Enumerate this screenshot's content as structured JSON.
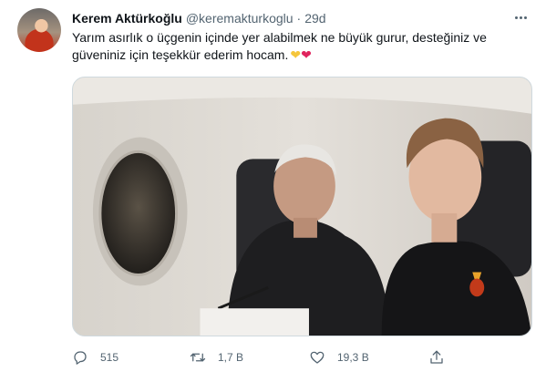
{
  "author": {
    "display_name": "Kerem Aktürkoğlu",
    "handle": "@keremakturkoglu",
    "separator": "·",
    "time": "29d"
  },
  "tweet": {
    "text": "Yarım asırlık o üçgenin içinde yer alabilmek ne büyük gurur, desteğiniz ve güveniniz için teşekkür ederim hocam.",
    "emoji_yellow_heart": "❤",
    "emoji_red_heart": "❤"
  },
  "actions": {
    "reply_count": "515",
    "retweet_count": "1,7 B",
    "like_count": "19,3 B"
  },
  "icons": [
    "more-icon",
    "reply-icon",
    "retweet-icon",
    "like-icon",
    "share-icon"
  ],
  "colors": {
    "text": "#0f1419",
    "secondary": "#536471",
    "border": "#cfd9de",
    "yellow_heart": "#f5c63c",
    "red_heart": "#e0245e"
  }
}
